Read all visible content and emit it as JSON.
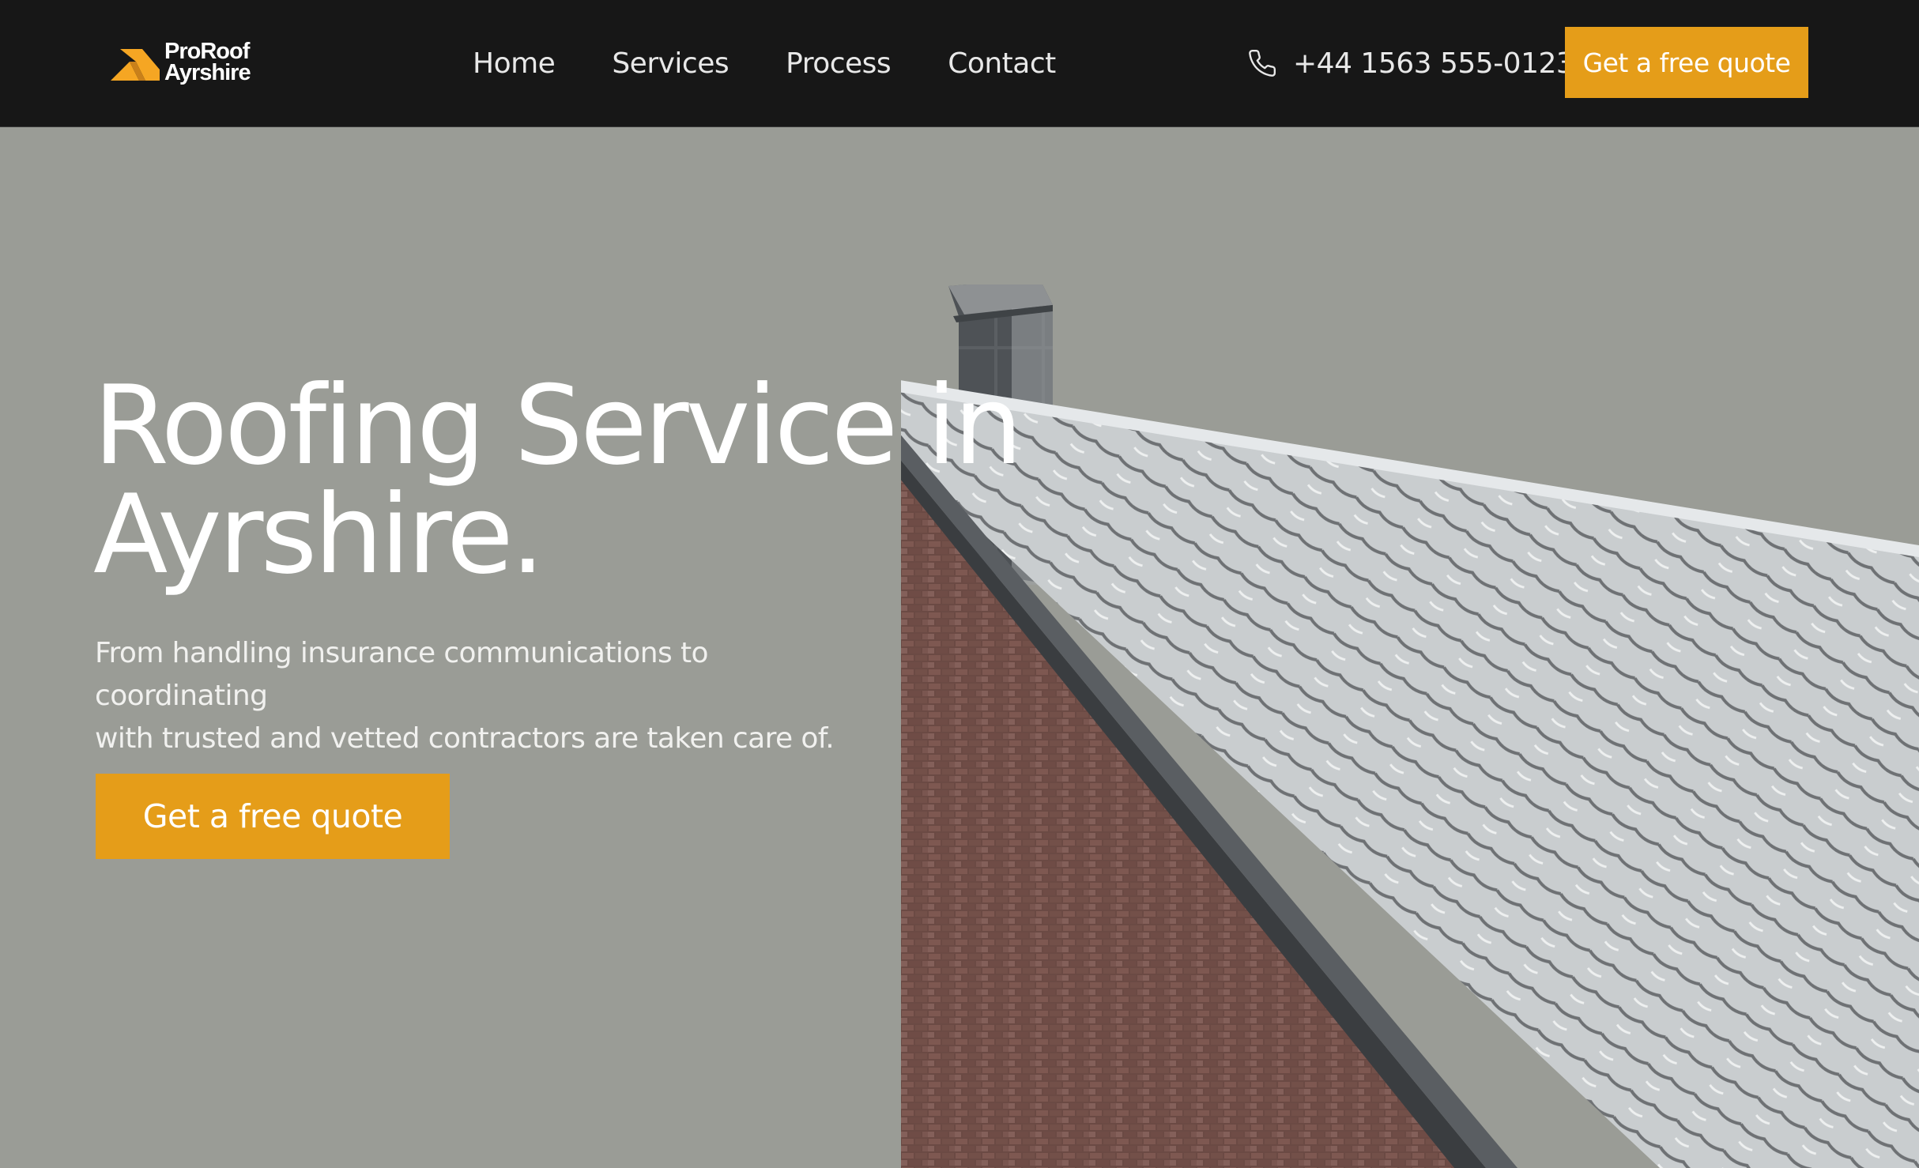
{
  "brand": {
    "line1": "ProRoof",
    "line2": "Ayrshire",
    "accent": "#f5a623"
  },
  "nav": {
    "items": [
      {
        "label": "Home"
      },
      {
        "label": "Services"
      },
      {
        "label": "Process"
      },
      {
        "label": "Contact"
      }
    ],
    "phone": "+44 1563 555-0123",
    "phone_icon": "phone-icon",
    "cta_label": "Get a free quote"
  },
  "hero": {
    "title_line1": "Roofing Service in",
    "title_line2": "Ayrshire.",
    "subtitle_line1": "From handling insurance communications to coordinating",
    "subtitle_line2": "with trusted and vetted contractors are taken care of.",
    "cta_label": "Get a free quote",
    "image": "brick-house-snowy-roof-image"
  },
  "colors": {
    "navbar_bg": "#171717",
    "hero_bg": "#9a9c96",
    "button": "#e59d19",
    "text": "#ffffff"
  }
}
